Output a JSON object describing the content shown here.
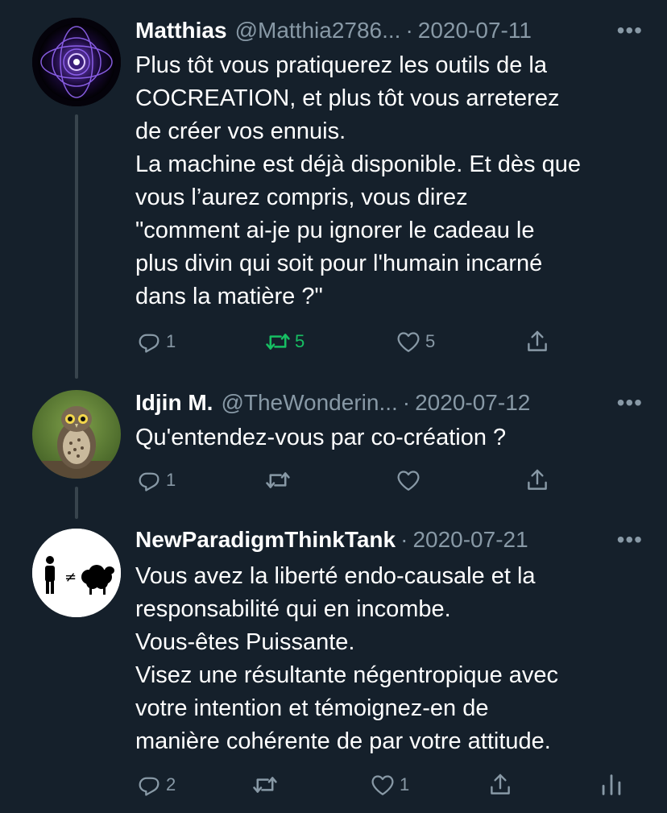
{
  "tweets": [
    {
      "name": "Matthias",
      "handle": "@Matthia2786...",
      "date": "2020-07-11",
      "more": "•••",
      "text": "Plus tôt vous pratiquerez les outils de la\nCOCREATION, et plus tôt vous arreterez\nde créer vos ennuis.\nLa machine est déjà disponible. Et dès que\nvous l’aurez compris, vous direz\n\"comment ai-je pu ignorer le cadeau le\nplus divin qui soit pour l'humain incarné\ndans la matière ?\"",
      "replies": "1",
      "retweets": "5",
      "likes": "5",
      "avatar_icon": "cosmic-eye-avatar"
    },
    {
      "name": "Idjin M.",
      "handle": "@TheWonderin...",
      "date": "2020-07-12",
      "more": "•••",
      "text": "Qu'entendez-vous par co-création ?",
      "replies": "1",
      "retweets": "",
      "likes": "",
      "avatar_icon": "owl-avatar"
    },
    {
      "name": "NewParadigmThinkTank",
      "handle": "",
      "date": "2020-07-21",
      "more": "•••",
      "text": "Vous avez la liberté endo-causale et la\nresponsabilité qui en incombe.\nVous-êtes Puissante.\nVisez une résultante négentropique avec\nvotre intention et témoignez-en de\nmanière cohérente de par votre attitude.",
      "replies": "2",
      "retweets": "",
      "likes": "1",
      "avatar_icon": "person-not-equal-sheep-avatar"
    }
  ],
  "colors": {
    "background": "#15202b",
    "text": "#ffffff",
    "secondary": "#8899a6",
    "retweeted": "#17bf63",
    "thread_line": "#38444d"
  }
}
